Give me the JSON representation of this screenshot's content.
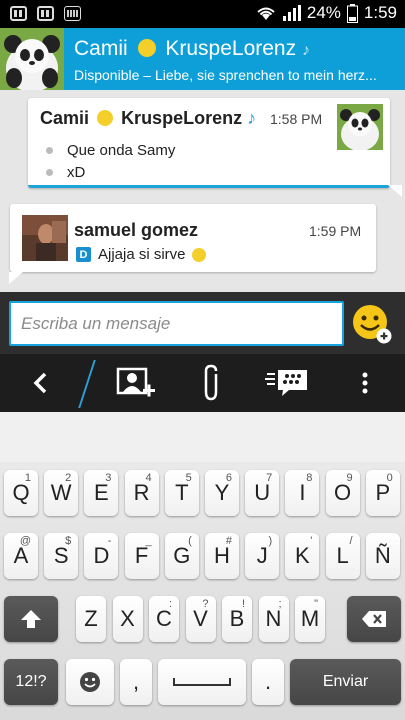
{
  "status_bar": {
    "battery": "24%",
    "time": "1:59"
  },
  "header": {
    "title_first": "Camii",
    "title_last": "KruspeLorenz",
    "status_line": "Disponible – Liebe, sie sprenchen to mein herz..."
  },
  "messages": [
    {
      "sender_first": "Camii",
      "sender_last": "KruspeLorenz",
      "time": "1:58 PM",
      "lines": [
        "Que onda Samy",
        "xD"
      ]
    },
    {
      "sender": "samuel gomez",
      "time": "1:59 PM",
      "badge": "D",
      "text": "Ajjaja si sirve"
    }
  ],
  "composer": {
    "placeholder": "Escriba un mensaje"
  },
  "toolbar": {
    "icons": [
      "back-icon",
      "add-contact-icon",
      "paperclip-icon",
      "bbm-broadcast-icon",
      "overflow-menu-icon"
    ]
  },
  "keyboard": {
    "row1": [
      {
        "k": "Q",
        "s": "1"
      },
      {
        "k": "W",
        "s": "2"
      },
      {
        "k": "E",
        "s": "3"
      },
      {
        "k": "R",
        "s": "4"
      },
      {
        "k": "T",
        "s": "5"
      },
      {
        "k": "Y",
        "s": "6"
      },
      {
        "k": "U",
        "s": "7"
      },
      {
        "k": "I",
        "s": "8"
      },
      {
        "k": "O",
        "s": "9"
      },
      {
        "k": "P",
        "s": "0"
      }
    ],
    "row2": [
      {
        "k": "A",
        "s": "@"
      },
      {
        "k": "S",
        "s": "$"
      },
      {
        "k": "D",
        "s": "-"
      },
      {
        "k": "F",
        "s": "_"
      },
      {
        "k": "G",
        "s": "("
      },
      {
        "k": "H",
        "s": "#"
      },
      {
        "k": "J",
        "s": ")"
      },
      {
        "k": "K",
        "s": "'"
      },
      {
        "k": "L",
        "s": "/"
      },
      {
        "k": "Ñ",
        "s": ""
      }
    ],
    "row3": [
      {
        "k": "Z",
        "s": ""
      },
      {
        "k": "X",
        "s": ""
      },
      {
        "k": "C",
        "s": ":"
      },
      {
        "k": "V",
        "s": "?"
      },
      {
        "k": "B",
        "s": "!"
      },
      {
        "k": "N",
        "s": ";"
      },
      {
        "k": "M",
        "s": "\""
      }
    ],
    "numbers_key": "12!?",
    "comma_key": ",",
    "period_key": ".",
    "send_key": "Enviar"
  }
}
